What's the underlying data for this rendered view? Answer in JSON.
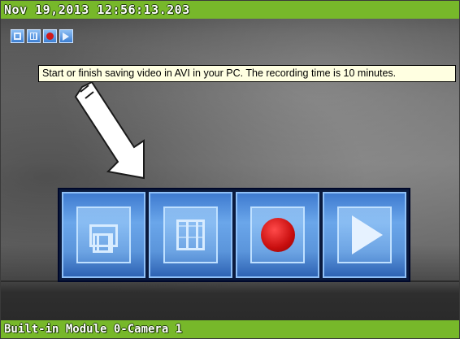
{
  "overlay": {
    "timestamp": "Nov 19,2013 12:56:13.203",
    "camera_name": "Built-in Module 0-Camera 1"
  },
  "small_toolbar": {
    "buttons": [
      {
        "icon": "snapshot-icon"
      },
      {
        "icon": "grid-icon"
      },
      {
        "icon": "record-icon"
      },
      {
        "icon": "play-icon"
      }
    ]
  },
  "tooltip": {
    "text": "Start or finish saving video in AVI in your PC. The recording time is 10 minutes."
  },
  "big_toolbar": {
    "buttons": [
      {
        "icon": "snapshot-icon"
      },
      {
        "icon": "grid-icon"
      },
      {
        "icon": "record-icon"
      },
      {
        "icon": "play-icon"
      }
    ]
  },
  "colors": {
    "status_bar": "#77b82a",
    "button_blue": "#5b95db",
    "record_red": "#d21818",
    "tooltip_bg": "#ffffe1"
  }
}
